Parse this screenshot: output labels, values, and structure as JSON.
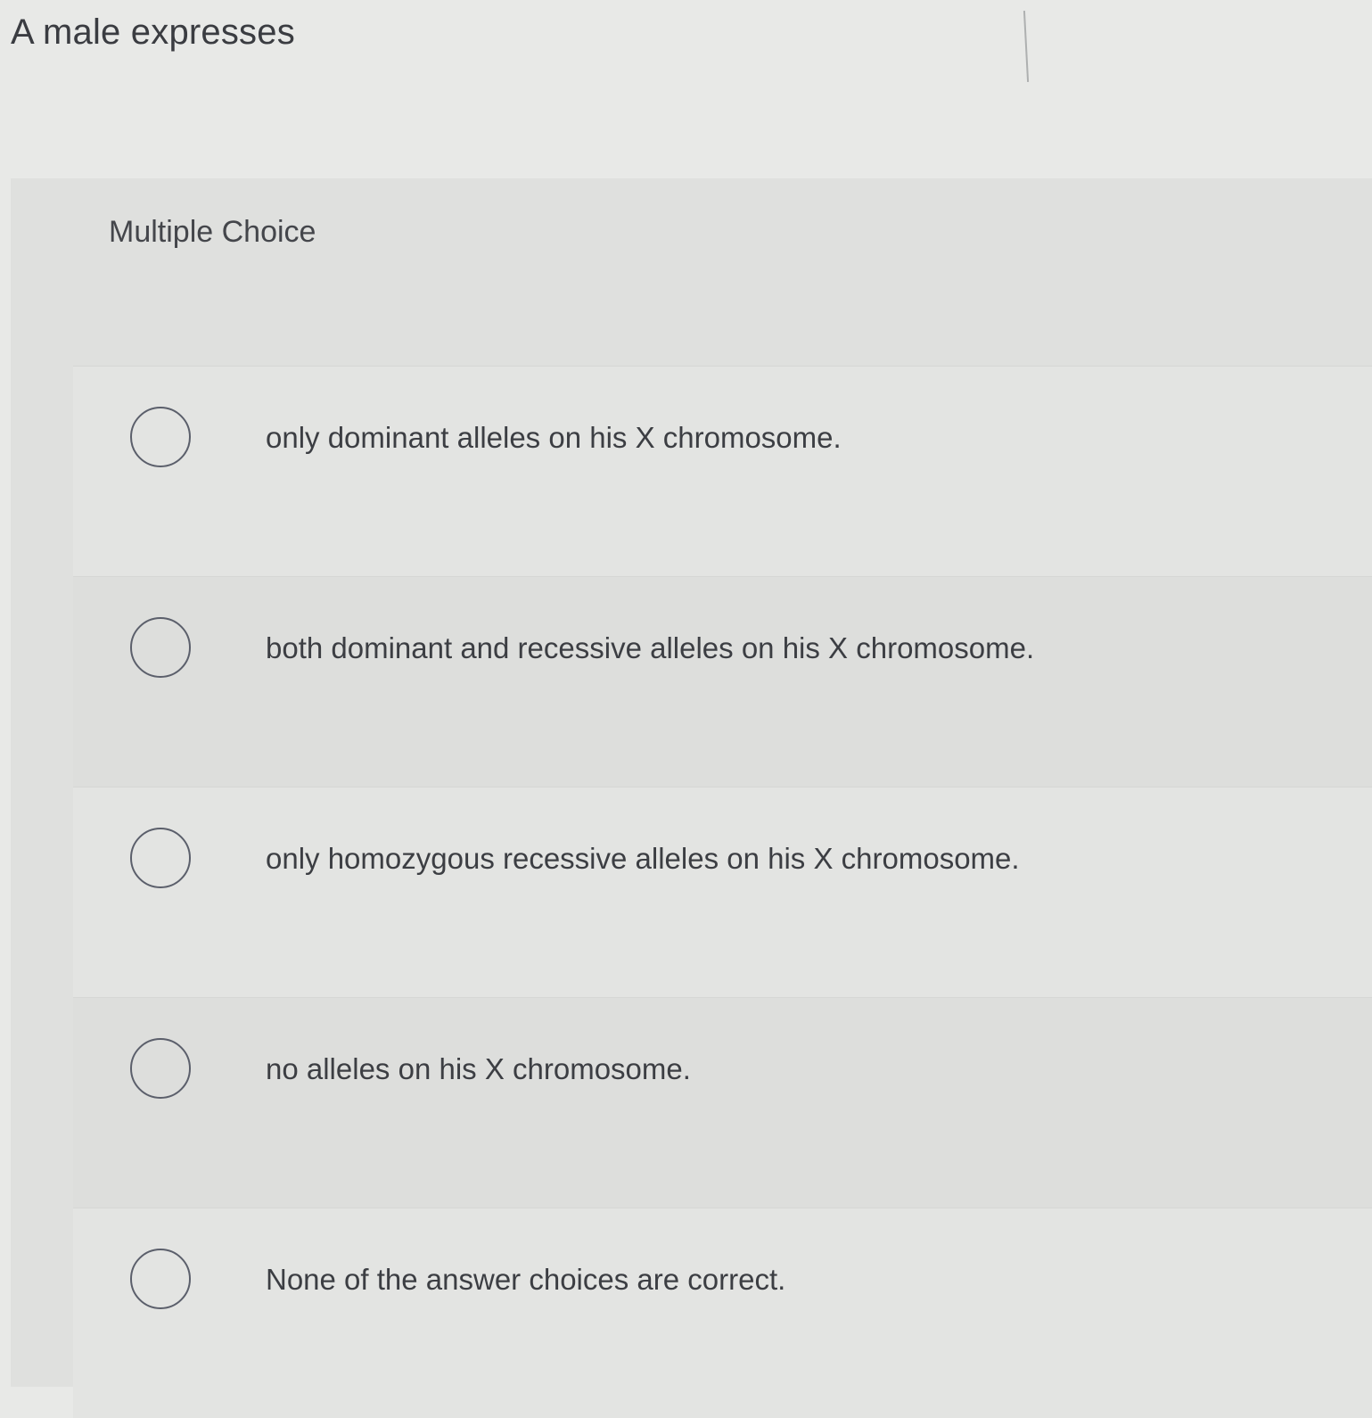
{
  "question": {
    "stem": "A male expresses"
  },
  "multiple_choice": {
    "label": "Multiple Choice",
    "options": [
      {
        "text": "only dominant alleles on his X chromosome.",
        "selected": false
      },
      {
        "text": "both dominant and recessive alleles on his X chromosome.",
        "selected": false
      },
      {
        "text": "only homozygous recessive alleles on his X chromosome.",
        "selected": false
      },
      {
        "text": "no alleles on his X chromosome.",
        "selected": false
      },
      {
        "text": "None of the answer choices are correct.",
        "selected": false
      }
    ]
  }
}
